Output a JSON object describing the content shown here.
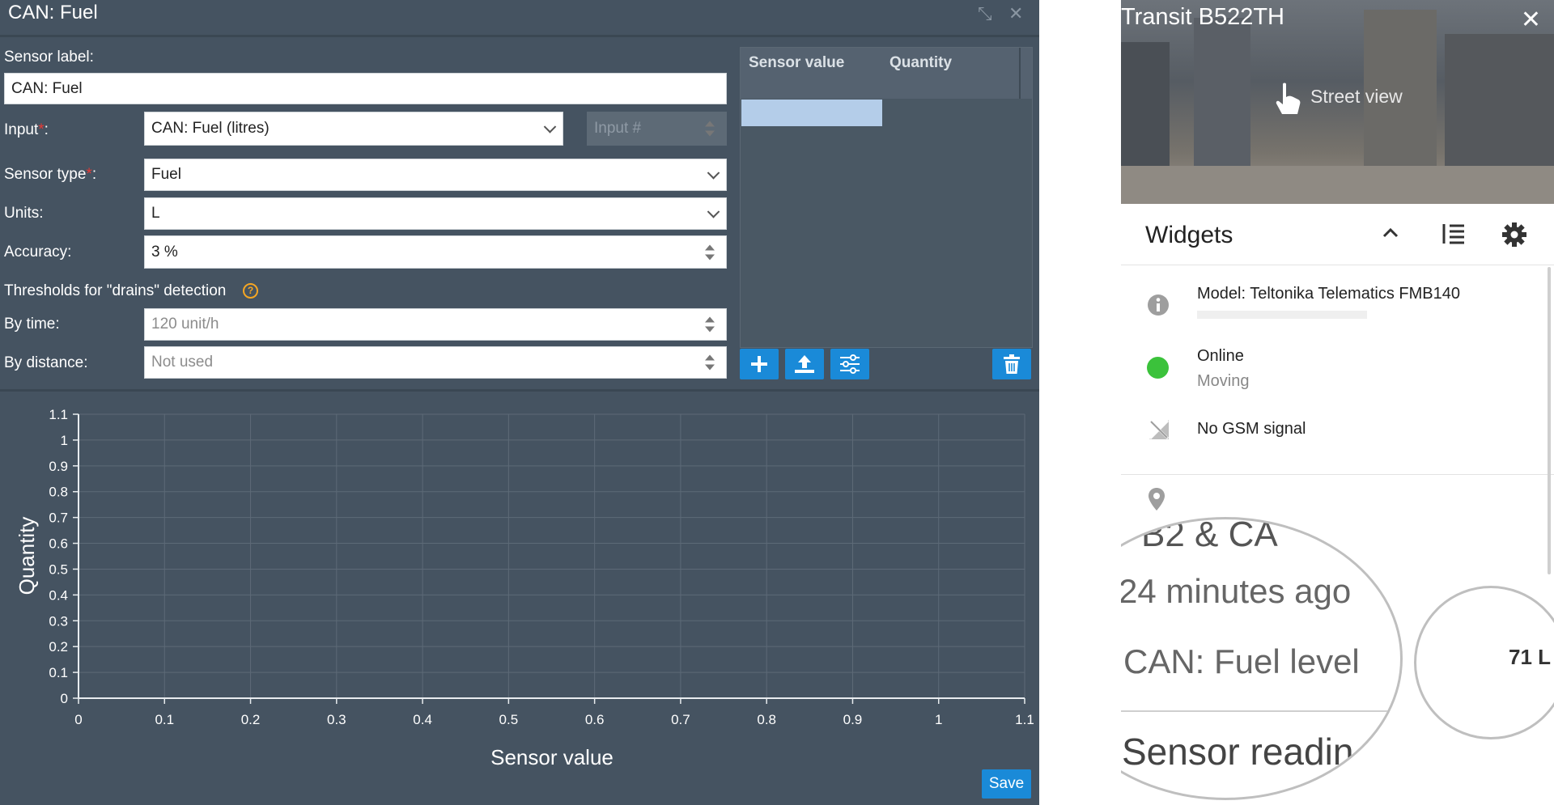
{
  "dialog": {
    "title": "CAN: Fuel",
    "labels": {
      "sensor_label": "Sensor label:",
      "input": "Input",
      "sensor_type": "Sensor type",
      "units": "Units:",
      "accuracy": "Accuracy:",
      "thresholds": "Thresholds for \"drains\" detection",
      "by_time": "By time:",
      "by_distance": "By distance:"
    },
    "required_mark": "*",
    "colon": ":",
    "help_glyph": "?",
    "values": {
      "sensor_label": "CAN: Fuel",
      "input": "CAN: Fuel (litres)",
      "input_number_placeholder": "Input #",
      "sensor_type": "Fuel",
      "units": "L",
      "accuracy": "3 %",
      "by_time_placeholder": "120 unit/h",
      "by_distance_placeholder": "Not used"
    },
    "table": {
      "col_sensor_value": "Sensor value",
      "col_quantity": "Quantity"
    },
    "save_label": "Save",
    "accent": "#1a8ad8",
    "background": "#455361"
  },
  "chart_data": {
    "type": "line",
    "xlabel": "Sensor value",
    "ylabel": "Quantity",
    "xlim": [
      0,
      1.1
    ],
    "ylim": [
      0,
      1.1
    ],
    "xticks": [
      "0",
      "0.1",
      "0.2",
      "0.3",
      "0.4",
      "0.5",
      "0.6",
      "0.7",
      "0.8",
      "0.9",
      "1",
      "1.1"
    ],
    "yticks": [
      "0",
      "0.1",
      "0.2",
      "0.3",
      "0.4",
      "0.5",
      "0.6",
      "0.7",
      "0.8",
      "0.9",
      "1",
      "1.1"
    ],
    "grid": true,
    "series": []
  },
  "panel": {
    "vehicle": "Transit B522TH",
    "street_view": "Street view",
    "widgets_title": "Widgets",
    "model": "Model: Teltonika Telematics FMB140",
    "status": "Online",
    "motion": "Moving",
    "gsm": "No GSM signal",
    "zoom_text_1": "B2 & CA",
    "zoom_text_2": "24 minutes ago",
    "zoom_text_3": "CAN: Fuel level",
    "zoom_text_4": "Sensor readin",
    "zoom_value": "71 L",
    "status_color": "#3bc23b"
  }
}
